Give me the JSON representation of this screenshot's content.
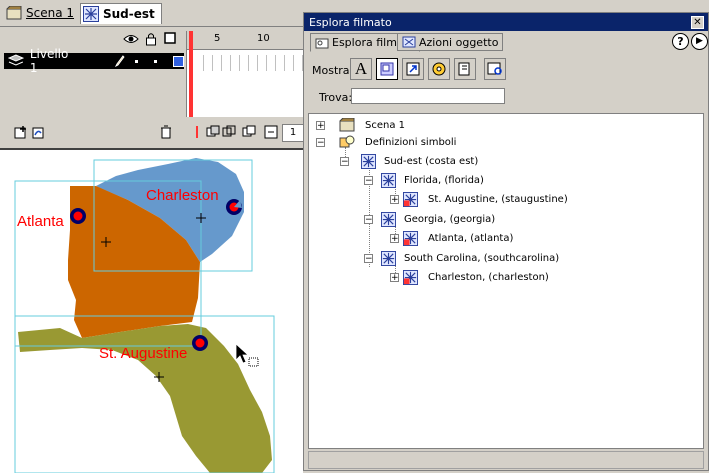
{
  "scene_bar": {
    "tabs": [
      {
        "label": "Scena 1"
      },
      {
        "label": "Sud-est"
      }
    ]
  },
  "timeline": {
    "layer_name": "Livello 1",
    "frame_numbers": [
      "1",
      "5",
      "10",
      "1"
    ],
    "current_frame": "1"
  },
  "stage": {
    "labels": [
      "Atlanta",
      "Charleston",
      "St. Augustine"
    ],
    "colors": {
      "georgia": "#cc6600",
      "south_carolina": "#6699cc",
      "florida": "#999933",
      "label": "#ff0000",
      "marker": "#000066"
    }
  },
  "panel": {
    "title": "Esplora filmato",
    "tabs": [
      "Esplora filmato",
      "Azioni oggetto"
    ],
    "show_label": "Mostra:",
    "find_label": "Trova:",
    "find_value": "",
    "tree": [
      {
        "label": "Scena 1"
      },
      {
        "label": "Definizioni simboli"
      },
      {
        "label": "Sud-est (costa est)"
      },
      {
        "label": "Florida, (florida)"
      },
      {
        "label": "St. Augustine, (staugustine)"
      },
      {
        "label": "Georgia, (georgia)"
      },
      {
        "label": "Atlanta, (atlanta)"
      },
      {
        "label": "South Carolina, (southcarolina)"
      },
      {
        "label": "Charleston, (charleston)"
      }
    ]
  }
}
